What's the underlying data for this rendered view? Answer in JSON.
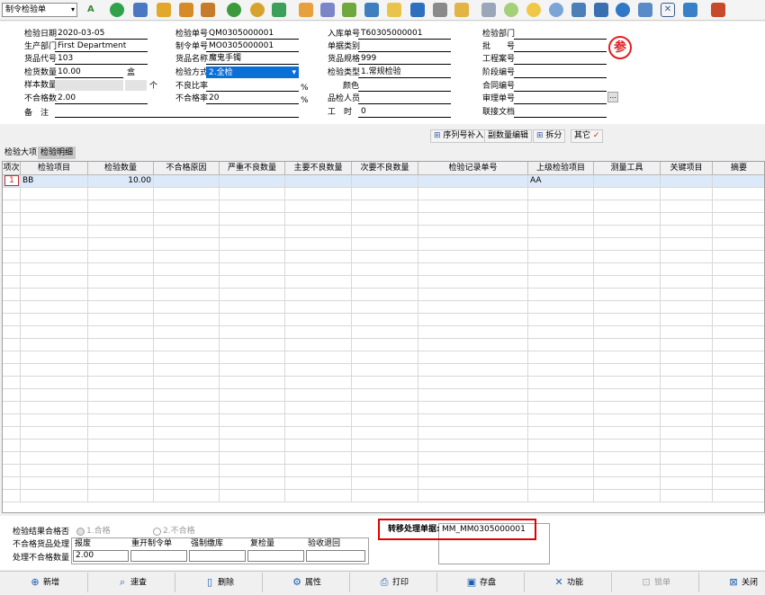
{
  "toolbar": {
    "select_value": "制令检验单",
    "icons": [
      "abc-icon",
      "phone-icon",
      "monitor-icon",
      "lock-icon",
      "briefcase-icon",
      "home-icon",
      "dollar-icon",
      "money-bag-icon",
      "cart-icon",
      "clipboard-icon",
      "users-icon",
      "link-icon",
      "help-icon",
      "mail-icon",
      "info-icon",
      "calculator-icon",
      "folder-icon",
      "copy-icon",
      "check-icon",
      "bell-icon",
      "search-icon",
      "org-chart-icon",
      "display-icon",
      "refresh-icon",
      "window-icon",
      "close-icon",
      "restore-icon",
      "book-icon"
    ]
  },
  "header": {
    "inspect_date_label": "检验日期",
    "inspect_date": "2020-03-05",
    "dept_label": "生产部门",
    "dept": "First Department",
    "product_code_label": "货品代号",
    "product_code": "103",
    "qty_label": "检货数量",
    "qty": "10.00",
    "qty_unit": "盒",
    "sample_label": "样本数量",
    "sample_unit": "个",
    "fail_qty_label": "不合格数",
    "fail_qty": "2.00",
    "remark_label": "备　注",
    "inspect_no_label": "检验单号",
    "inspect_no": "QM0305000001",
    "order_no_label": "制令单号",
    "order_no": "MO0305000001",
    "product_name_label": "货品名称",
    "product_name": "魔鬼手镯",
    "method_label": "检验方式",
    "method": "2.全检",
    "defect_rate_label": "不良比率",
    "pct": "%",
    "fail_rate_label": "不合格率",
    "fail_rate": "20",
    "in_no_label": "入库单号",
    "in_no": "T60305000001",
    "doc_type_label": "单据类别",
    "spec_label": "货品规格",
    "spec": "999",
    "inspect_type_label": "检验类型",
    "inspect_type": "1.常规检验",
    "color_label": "颜色",
    "inspector_label": "品检人员",
    "hours_label": "工　时",
    "hours": "0",
    "inspect_dept_label": "检验部门",
    "batch_label": "批　　号",
    "project_label": "工程案号",
    "stage_label": "阶段编号",
    "contract_label": "合同编号",
    "audit_label": "审理单号",
    "link_label": "联接文档",
    "stamp": "参"
  },
  "actions": {
    "serial": "序列号补入",
    "sub_qty": "副数量编辑",
    "split": "拆分",
    "other": "其它"
  },
  "tabs": [
    "检验大项",
    "检验明细"
  ],
  "grid": {
    "columns": [
      "项次",
      "检验项目",
      "检验数量",
      "不合格原因",
      "严重不良数量",
      "主要不良数量",
      "次要不良数量",
      "检验记录单号",
      "上级检验项目",
      "测量工具",
      "关键项目",
      "摘要"
    ],
    "rows": [
      {
        "no": "1",
        "item": "BB",
        "qty": "10.00",
        "parent": "AA"
      }
    ]
  },
  "bottom": {
    "result_label": "检验结果合格否",
    "pass_opt": "1.合格",
    "fail_opt": "2.不合格",
    "fail_handle_label": "不合格货品处理",
    "fail_handle_qty_label": "处理不合格数量",
    "handle_cols": [
      "报废",
      "重开制令单",
      "强制缴库",
      "复检量",
      "验收退回"
    ],
    "scrap_value": "2.00",
    "transfer_label": "转移处理单据:",
    "transfer_value": "MM_MM0305000001"
  },
  "footer": {
    "add": "新增",
    "query": "速查",
    "delete": "删除",
    "property": "属性",
    "print": "打印",
    "save": "存盘",
    "function": "功能",
    "lock": "锁单",
    "close": "关闭"
  },
  "colors": {
    "accent": "#0b6fd8",
    "stamp": "#e02020",
    "highlight_box": "#e00000"
  }
}
